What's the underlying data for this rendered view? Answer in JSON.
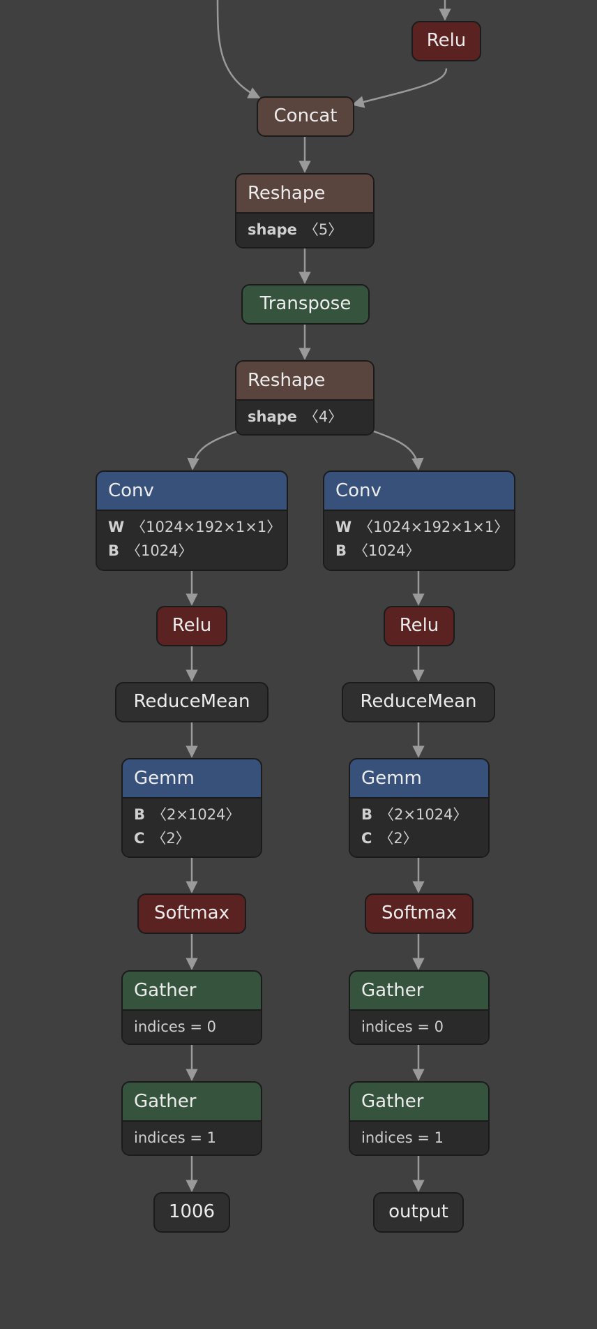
{
  "nodes": {
    "relu_top": "Relu",
    "concat": "Concat",
    "reshape1": {
      "op": "Reshape",
      "attrs": [
        {
          "k": "shape",
          "v": "〈5〉"
        }
      ]
    },
    "transpose": "Transpose",
    "reshape2": {
      "op": "Reshape",
      "attrs": [
        {
          "k": "shape",
          "v": "〈4〉"
        }
      ]
    },
    "left": {
      "conv": {
        "op": "Conv",
        "attrs": [
          {
            "k": "W",
            "v": "〈1024×192×1×1〉"
          },
          {
            "k": "B",
            "v": "〈1024〉"
          }
        ]
      },
      "relu": "Relu",
      "reducemean": "ReduceMean",
      "gemm": {
        "op": "Gemm",
        "attrs": [
          {
            "k": "B",
            "v": "〈2×1024〉"
          },
          {
            "k": "C",
            "v": "〈2〉"
          }
        ]
      },
      "softmax": "Softmax",
      "gather1": {
        "op": "Gather",
        "attr": "indices = 0"
      },
      "gather2": {
        "op": "Gather",
        "attr": "indices = 1"
      },
      "output": "1006"
    },
    "right": {
      "conv": {
        "op": "Conv",
        "attrs": [
          {
            "k": "W",
            "v": "〈1024×192×1×1〉"
          },
          {
            "k": "B",
            "v": "〈1024〉"
          }
        ]
      },
      "relu": "Relu",
      "reducemean": "ReduceMean",
      "gemm": {
        "op": "Gemm",
        "attrs": [
          {
            "k": "B",
            "v": "〈2×1024〉"
          },
          {
            "k": "C",
            "v": "〈2〉"
          }
        ]
      },
      "softmax": "Softmax",
      "gather1": {
        "op": "Gather",
        "attr": "indices = 0"
      },
      "gather2": {
        "op": "Gather",
        "attr": "indices = 1"
      },
      "output": "output"
    }
  },
  "colors": {
    "background": "#404040",
    "edge": "#9a9a9a",
    "relu": "#5a2220",
    "reshape": "#5a443e",
    "transpose": "#35533d",
    "conv": "#37517a"
  }
}
